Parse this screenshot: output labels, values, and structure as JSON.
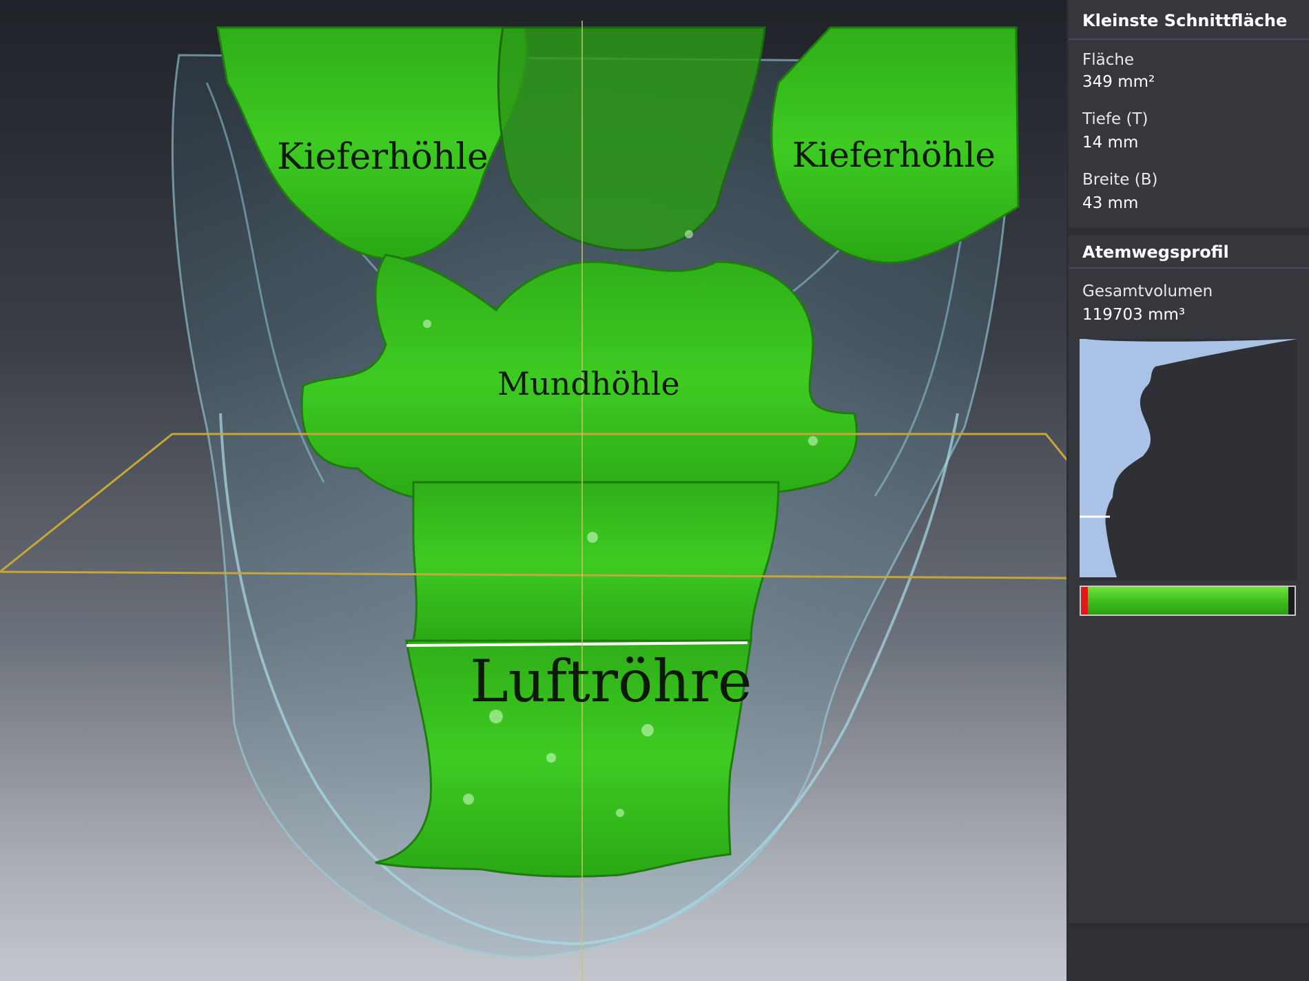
{
  "viewport": {
    "labels": {
      "maxillary_left": "Kieferhöhle",
      "maxillary_right": "Kieferhöhle",
      "oral_cavity": "Mundhöhle",
      "trachea": "Luftröhre"
    },
    "colors": {
      "airway": "#33c21c",
      "tissue": "#7fb4c4",
      "slice_plane": "#c9a63a"
    }
  },
  "panel": {
    "smallest_section": {
      "title": "Kleinste Schnittfläche",
      "area_label": "Fläche",
      "area_value": "349 mm²",
      "depth_label": "Tiefe (T)",
      "depth_value": "14 mm",
      "width_label": "Breite (B)",
      "width_value": "43 mm"
    },
    "airway_profile": {
      "title": "Atemwegsprofil",
      "volume_label": "Gesamtvolumen",
      "volume_value": "119703 mm³",
      "profile_color": "#a9c2e6",
      "indicator_level": 0.97,
      "indicator_colors": {
        "low": "#e01818",
        "ok": "#3fbf1e"
      }
    }
  }
}
